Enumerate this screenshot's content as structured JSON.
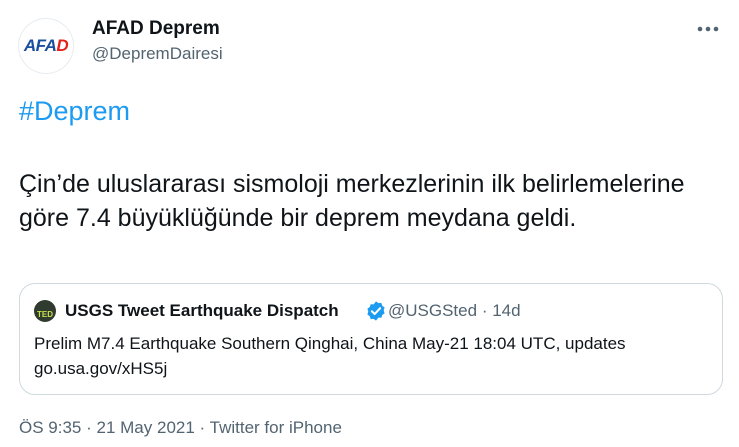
{
  "author": {
    "avatar_text_main": "AFAD",
    "display_name": "AFAD Deprem",
    "handle": "@DepremDairesi"
  },
  "tweet": {
    "hashtag": "#Deprem",
    "text": "Çin’de uluslararası sismoloji merkezlerinin ilk belirlemelerine göre 7.4 büyüklüğünde bir deprem meydana geldi."
  },
  "quoted_tweet": {
    "avatar_text": "TED",
    "display_name": "USGS Tweet Earthquake Dispatch",
    "handle": "@USGSted",
    "separator": "·",
    "age": "14d",
    "text": "Prelim M7.4 Earthquake Southern Qinghai, China May-21 18:04 UTC, updates go.usa.gov/xHS5j"
  },
  "meta": {
    "time": "ÖS 9:35",
    "separator": "·",
    "date": "21 May 2021",
    "source": "Twitter for iPhone"
  },
  "icons": {
    "more": "more-horizontal-icon",
    "verified": "verified-badge-icon"
  },
  "colors": {
    "link": "#1d9bf0",
    "secondary_text": "#536471",
    "verified": "#1d9bf0",
    "afad_blue": "#1a4fa0",
    "afad_red": "#e2231a"
  }
}
